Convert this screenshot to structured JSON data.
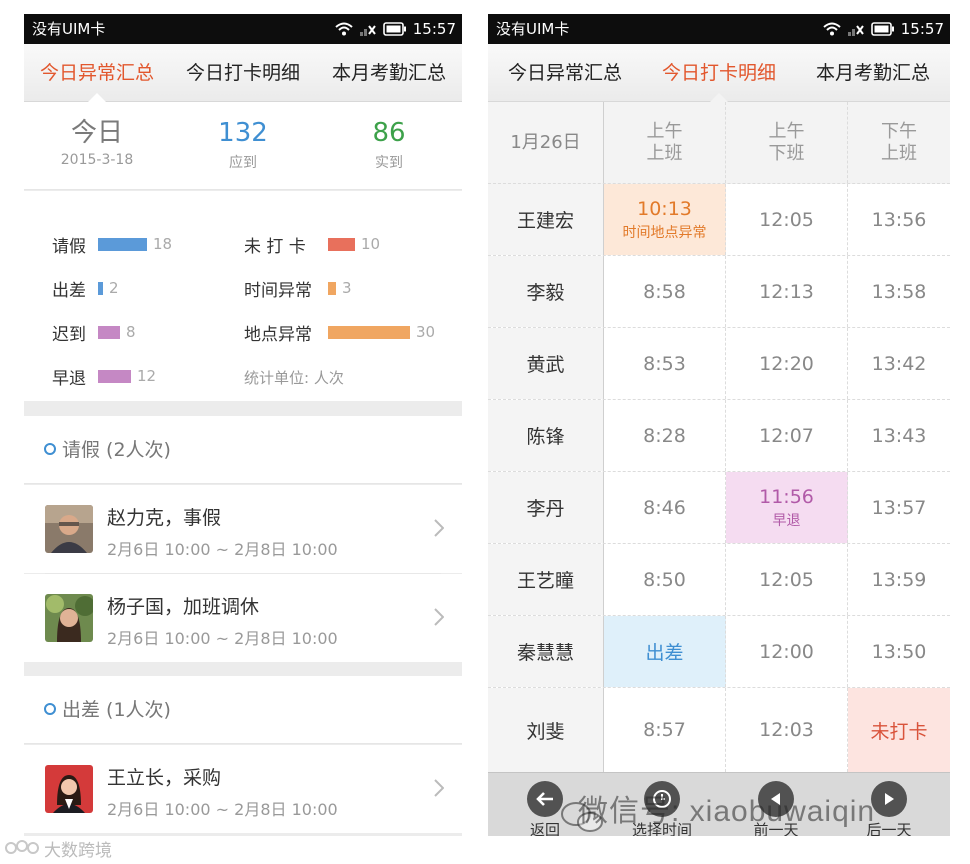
{
  "status_bar": {
    "carrier": "没有UIM卡",
    "time": "15:57"
  },
  "tabs": [
    "今日异常汇总",
    "今日打卡明细",
    "本月考勤汇总"
  ],
  "left": {
    "summary": [
      {
        "value": "今日",
        "label": "2015-3-18"
      },
      {
        "value": "132",
        "label": "应到"
      },
      {
        "value": "86",
        "label": "实到"
      }
    ],
    "stats": [
      {
        "label": "请假",
        "value": "18",
        "color": "#5b9ad9"
      },
      {
        "label": "未 打 卡",
        "value": "10",
        "color": "#e8705c"
      },
      {
        "label": "出差",
        "value": "2",
        "color": "#5b9ad9"
      },
      {
        "label": "时间异常",
        "value": "3",
        "color": "#f0a661"
      },
      {
        "label": "迟到",
        "value": "8",
        "color": "#c588c4"
      },
      {
        "label": "地点异常",
        "value": "30",
        "color": "#f0a661"
      },
      {
        "label": "早退",
        "value": "12",
        "color": "#c588c4"
      }
    ],
    "stat_note": "统计单位: 人次",
    "sections": [
      {
        "title": "请假 (2人次)",
        "items": [
          {
            "title": "赵力克，事假",
            "time": "2月6日 10:00 ~ 2月8日 10:00"
          },
          {
            "title": "杨子国，加班调休",
            "time": "2月6日 10:00 ~ 2月8日 10:00"
          }
        ]
      },
      {
        "title": "出差 (1人次)",
        "items": [
          {
            "title": "王立长，采购",
            "time": "2月6日 10:00 ~ 2月8日 10:00"
          }
        ]
      }
    ]
  },
  "right": {
    "date": "1月26日",
    "columns": [
      {
        "line1": "上午",
        "line2": "上班"
      },
      {
        "line1": "上午",
        "line2": "下班"
      },
      {
        "line1": "下午",
        "line2": "上班"
      }
    ],
    "rows": [
      {
        "name": "王建宏",
        "c1": "10:13",
        "c1_sub": "时间地点异常",
        "c2": "12:05",
        "c3": "13:56"
      },
      {
        "name": "李毅",
        "c1": "8:58",
        "c2": "12:13",
        "c3": "13:58"
      },
      {
        "name": "黄武",
        "c1": "8:53",
        "c2": "12:20",
        "c3": "13:42"
      },
      {
        "name": "陈锋",
        "c1": "8:28",
        "c2": "12:07",
        "c3": "13:43"
      },
      {
        "name": "李丹",
        "c1": "8:46",
        "c2": "11:56",
        "c2_sub": "早退",
        "c3": "13:57"
      },
      {
        "name": "王艺瞳",
        "c1": "8:50",
        "c2": "12:05",
        "c3": "13:59"
      },
      {
        "name": "秦慧慧",
        "c1": "出差",
        "c2": "12:00",
        "c3": "13:50"
      },
      {
        "name": "刘斐",
        "c1": "8:57",
        "c2": "12:03",
        "c3": "未打卡"
      }
    ],
    "bottom": [
      "返回",
      "选择时间",
      "前一天",
      "后一天"
    ]
  },
  "watermark": "微信号: xiaobuwaiqin",
  "corner_logo": "大数跨境"
}
